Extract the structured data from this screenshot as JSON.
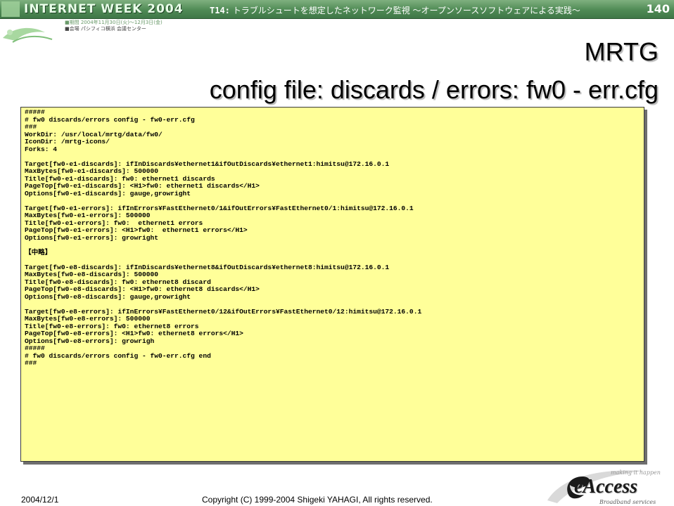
{
  "header": {
    "logo_text": "INTERNET WEEK 2004",
    "session_code": "T14:",
    "session_title": "トラブルシュートを想定したネットワーク監視 ～オープンソースソフトウェアによる実践～",
    "page_number": "140",
    "event_dates": "■期間 2004年11月30日(火)～12月3日(金)",
    "event_venue": "■会場 パシフィコ横浜 会議センター"
  },
  "slide": {
    "title_line1": "MRTG",
    "title_line2": "config file: discards / errors: fw0 - err.cfg"
  },
  "code_lines": [
    "#####",
    "# fw0 discards/errors config - fw0-err.cfg",
    "###",
    "WorkDir: /usr/local/mrtg/data/fw0/",
    "IconDir: /mrtg-icons/",
    "Forks: 4",
    "",
    "Target[fw0-e1-discards]: ifInDiscards¥ethernet1&ifOutDiscards¥ethernet1:himitsu@172.16.0.1",
    "MaxBytes[fw0-e1-discards]: 500000",
    "Title[fw0-e1-discards]: fw0: ethernet1 discards",
    "PageTop[fw0-e1-discards]: <H1>fw0: ethernet1 discards</H1>",
    "Options[fw0-e1-discards]: gauge,growright",
    "",
    "Target[fw0-e1-errors]: ifInErrors¥FastEthernet0/1&ifOutErrors¥FastEthernet0/1:himitsu@172.16.0.1",
    "MaxBytes[fw0-e1-errors]: 500000",
    "Title[fw0-e1-errors]: fw0:  ethernet1 errors",
    "PageTop[fw0-e1-errors]: <H1>fw0:  ethernet1 errors</H1>",
    "Options[fw0-e1-errors]: growright",
    "",
    "【中略】",
    "",
    "Target[fw0-e8-discards]: ifInDiscards¥ethernet8&ifOutDiscards¥ethernet8:himitsu@172.16.0.1",
    "MaxBytes[fw0-e8-discards]: 500000",
    "Title[fw0-e8-discards]: fw0: ethernet8 discard",
    "PageTop[fw0-e8-discards]: <H1>fw0: ethernet8 discards</H1>",
    "Options[fw0-e8-discards]: gauge,growright",
    "",
    "Target[fw0-e8-errors]: ifInErrors¥FastEthernet0/12&ifOutErrors¥FastEthernet0/12:himitsu@172.16.0.1",
    "MaxBytes[fw0-e8-errors]: 500000",
    "Title[fw0-e8-errors]: fw0: ethernet8 errors",
    "PageTop[fw0-e8-errors]: <H1>fw0: ethernet8 errors</H1>",
    "Options[fw0-e8-errors]: growrigh",
    "#####",
    "# fw0 discards/errors config - fw0-err.cfg end",
    "###"
  ],
  "footer": {
    "date": "2004/12/1",
    "copyright": "Copyright (C) 1999-2004 Shigeki YAHAGI, All rights reserved."
  },
  "logo": {
    "brand": "eAccess",
    "tagline": "making it happen",
    "subline": "Broadband services"
  },
  "colors": {
    "header_green": "#4f8a55",
    "code_background": "#ffff99"
  }
}
